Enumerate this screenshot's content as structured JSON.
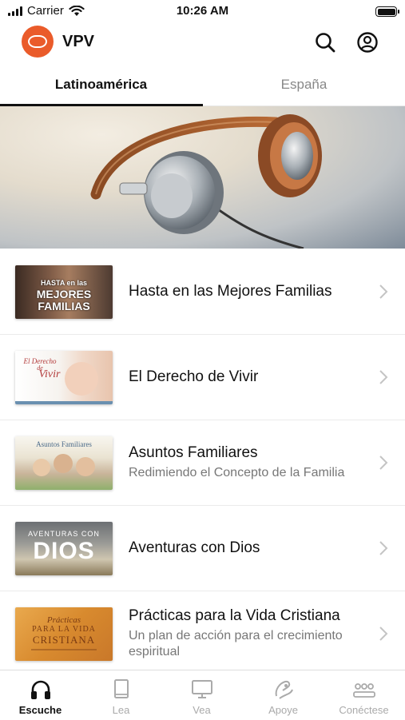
{
  "status": {
    "carrier": "Carrier",
    "time": "10:26 AM"
  },
  "app": {
    "name": "VPV"
  },
  "tabs": [
    {
      "label": "Latinoamérica"
    },
    {
      "label": "España"
    }
  ],
  "programs": [
    {
      "title": "Hasta en las Mejores Familias",
      "subtitle": "",
      "thumb_text": [
        "HASTA en las",
        "MEJORES",
        "FAMILIAS"
      ]
    },
    {
      "title": "El Derecho de Vivir",
      "subtitle": "",
      "thumb_text": [
        "El Derecho",
        "de",
        "Vivir"
      ]
    },
    {
      "title": "Asuntos Familiares",
      "subtitle": "Redimiendo el Concepto de la Familia",
      "thumb_text": [
        "Asuntos Familiares"
      ]
    },
    {
      "title": "Aventuras con Dios",
      "subtitle": "",
      "thumb_text": [
        "AVENTURAS CON",
        "DIOS"
      ]
    },
    {
      "title": "Prácticas para la Vida Cristiana",
      "subtitle": "Un plan de acción para el crecimiento espiritual",
      "thumb_text": [
        "Prácticas",
        "PARA LA VIDA",
        "CRISTIANA"
      ]
    }
  ],
  "nav": [
    {
      "label": "Escuche",
      "icon": "headphones-icon"
    },
    {
      "label": "Lea",
      "icon": "book-icon"
    },
    {
      "label": "Vea",
      "icon": "monitor-icon"
    },
    {
      "label": "Apoye",
      "icon": "support-hand-icon"
    },
    {
      "label": "Conéctese",
      "icon": "group-icon"
    }
  ],
  "colors": {
    "brand": "#ea5b2a",
    "active": "#111111",
    "inactive": "#aaaaaa"
  }
}
